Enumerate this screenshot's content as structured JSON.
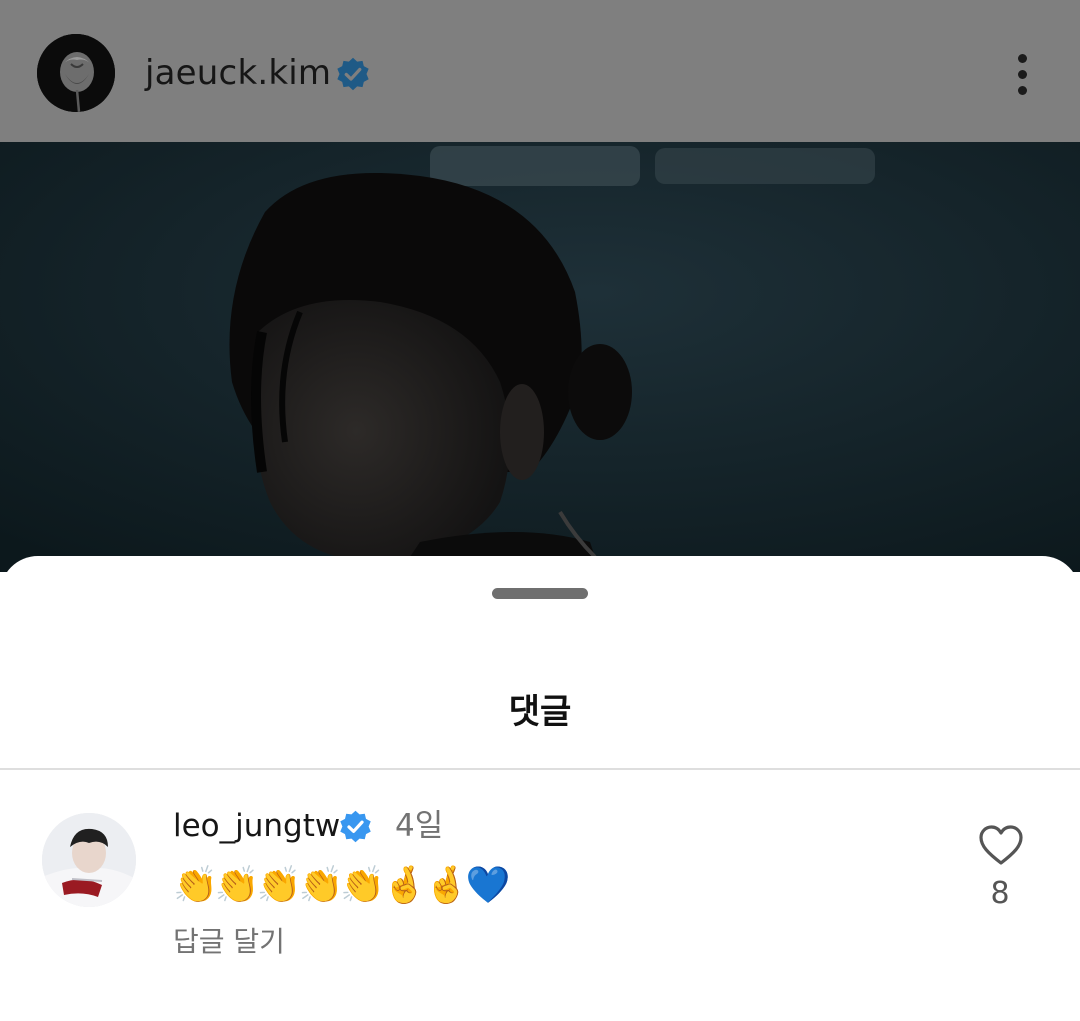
{
  "post": {
    "author": {
      "username": "jaeuck.kim",
      "verified": true
    },
    "icons": {
      "more": "more-vertical-icon",
      "verified": "verified-badge-icon"
    }
  },
  "comments_sheet": {
    "title": "댓글",
    "comments": [
      {
        "username": "leo_jungtw",
        "verified": true,
        "time": "4일",
        "text": "👏👏👏👏👏🤞🤞💙",
        "reply_label": "답글 달기",
        "like_count": "8",
        "liked": false
      }
    ]
  },
  "colors": {
    "verified_badge": "#3897f0",
    "dim_overlay_header": "#7f7f7f",
    "secondary_text": "#737373"
  }
}
